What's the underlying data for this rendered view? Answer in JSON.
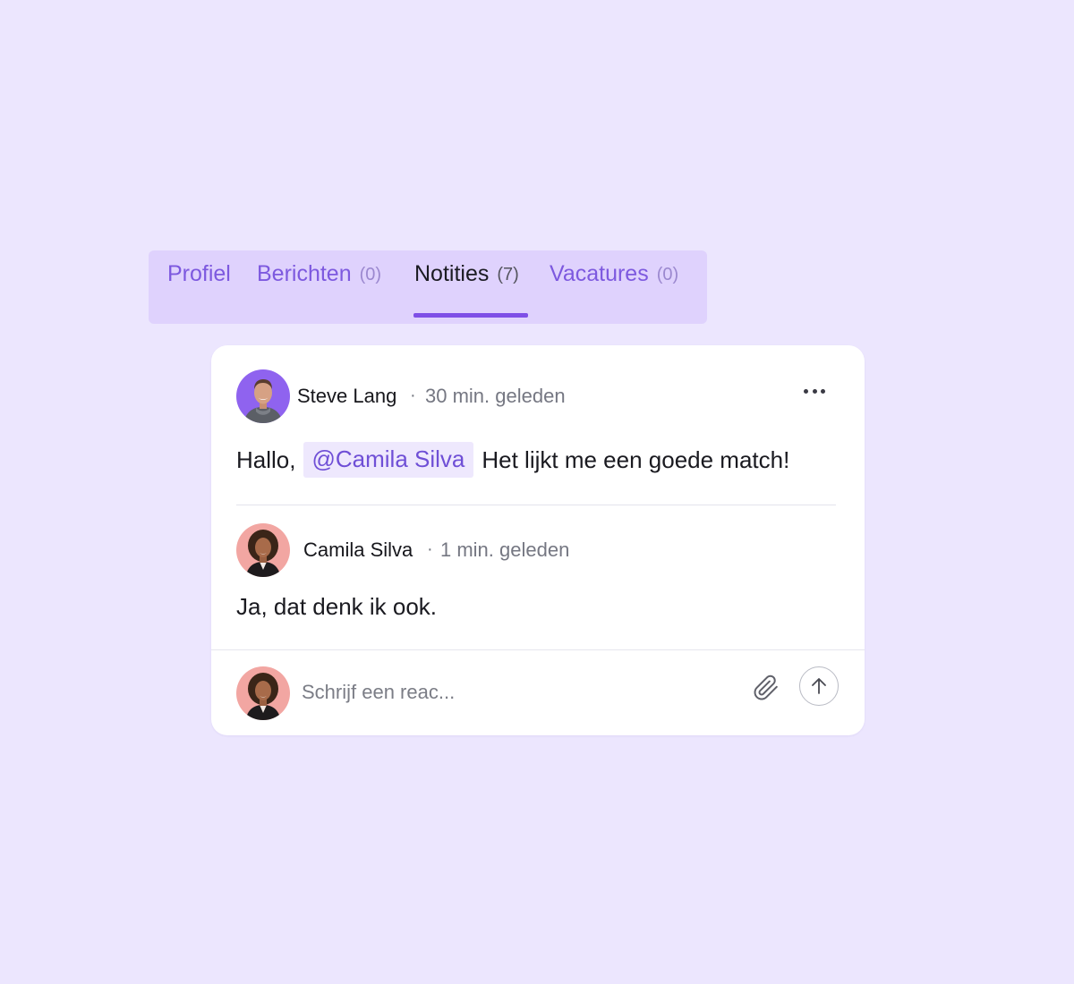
{
  "tabs": [
    {
      "label": "Profiel",
      "count": ""
    },
    {
      "label": "Berichten",
      "count": "(0)"
    },
    {
      "label": "Notities",
      "count": "(7)",
      "active": true
    },
    {
      "label": "Vacatures",
      "count": "(0)"
    }
  ],
  "notes": {
    "comment": {
      "author": "Steve Lang",
      "separator": "·",
      "time": "30 min. geleden",
      "text_before": "Hallo,",
      "mention": "@Camila Silva",
      "text_after": "Het lijkt me een goede match!"
    },
    "reply": {
      "author": "Camila Silva",
      "separator": "·",
      "time": "1 min. geleden",
      "text": "Ja, dat denk ik ook."
    },
    "composer": {
      "placeholder": "Schrijf een reac..."
    }
  },
  "icons": {
    "more": "more-horizontal-icon",
    "attach": "paperclip-icon",
    "send": "arrow-up-icon"
  },
  "colors": {
    "background": "#ece6fe",
    "tab_bar": "#dfd2fd",
    "accent": "#7e4fe6",
    "tab_text": "#7d59df",
    "mention_bg": "#eee8fd",
    "mention_text": "#6f4fd6"
  }
}
